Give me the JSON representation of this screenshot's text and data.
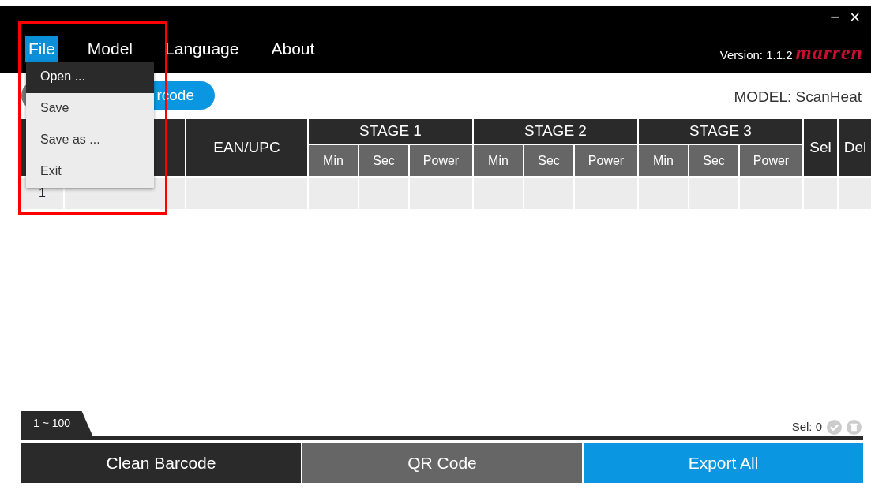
{
  "window": {
    "controls": [
      "−",
      "×"
    ]
  },
  "menu": [
    {
      "label": "File",
      "selected": true
    },
    {
      "label": "Model",
      "selected": false
    },
    {
      "label": "Language",
      "selected": false
    },
    {
      "label": "About",
      "selected": false
    }
  ],
  "version": "Version: 1.1.2",
  "logo": "marren",
  "dropdown": [
    {
      "label": "Open ...",
      "selected": true
    },
    {
      "label": "Save",
      "selected": false
    },
    {
      "label": "Save as ...",
      "selected": false
    },
    {
      "label": "Exit",
      "selected": false
    }
  ],
  "barcode_button": "rcode",
  "model": "MODEL: ScanHeat",
  "table": {
    "ean_header": "EAN/UPC",
    "stages": [
      {
        "title": "STAGE 1",
        "columns": [
          "Min",
          "Sec",
          "Power"
        ]
      },
      {
        "title": "STAGE 2",
        "columns": [
          "Min",
          "Sec",
          "Power"
        ]
      },
      {
        "title": "STAGE 3",
        "columns": [
          "Min",
          "Sec",
          "Power"
        ]
      }
    ],
    "sel_header": "Sel",
    "del_header": "Del",
    "rows": [
      {
        "number": "1"
      }
    ]
  },
  "page_tab": {
    "label": "1 ~ 100",
    "selected": true
  },
  "selection": "Sel: 0",
  "buttons": [
    {
      "label": "Clean Barcode",
      "kind": "dark"
    },
    {
      "label": "QR Code",
      "kind": "gray"
    },
    {
      "label": "Export All",
      "kind": "blue"
    }
  ]
}
